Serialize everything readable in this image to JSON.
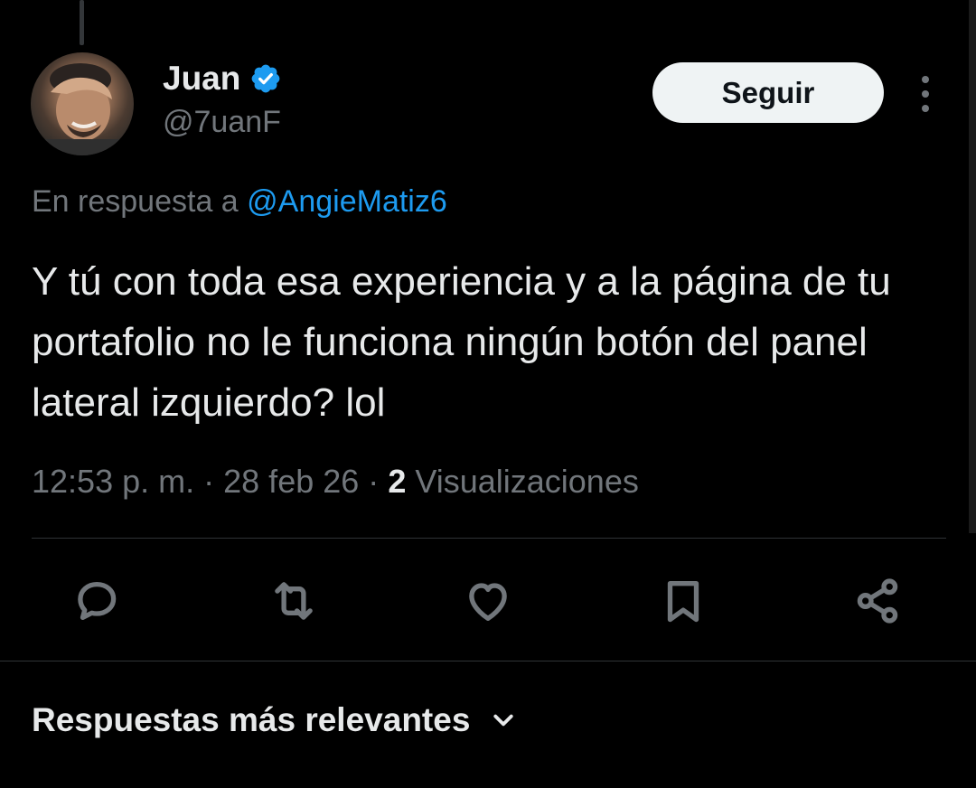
{
  "author": {
    "name": "Juan",
    "handle": "@7uanF",
    "verified": true,
    "verified_color": "#1d9bf0"
  },
  "header": {
    "follow_label": "Seguir",
    "more_icon": "more-vertical-icon"
  },
  "reply_context": {
    "prefix": "En respuesta a",
    "mention": "@AngieMatiz6"
  },
  "tweet": {
    "text": "Y tú con toda esa experiencia y a la página de tu portafolio no le funciona ningún botón del panel lateral izquierdo? lol",
    "time": "12:53 p. m.",
    "date": "28 feb 26",
    "separator": "·",
    "views_count": "2",
    "views_label": "Visualizaciones"
  },
  "actions": [
    {
      "name": "reply-icon"
    },
    {
      "name": "retweet-icon"
    },
    {
      "name": "like-icon"
    },
    {
      "name": "bookmark-icon"
    },
    {
      "name": "share-icon"
    }
  ],
  "replies_sort": {
    "label": "Respuestas más relevantes",
    "icon": "chevron-down-icon"
  },
  "colors": {
    "background": "#000000",
    "text": "#e7e9ea",
    "secondary": "#71767b",
    "link": "#1d9bf0",
    "button_bg": "#eff3f4"
  }
}
